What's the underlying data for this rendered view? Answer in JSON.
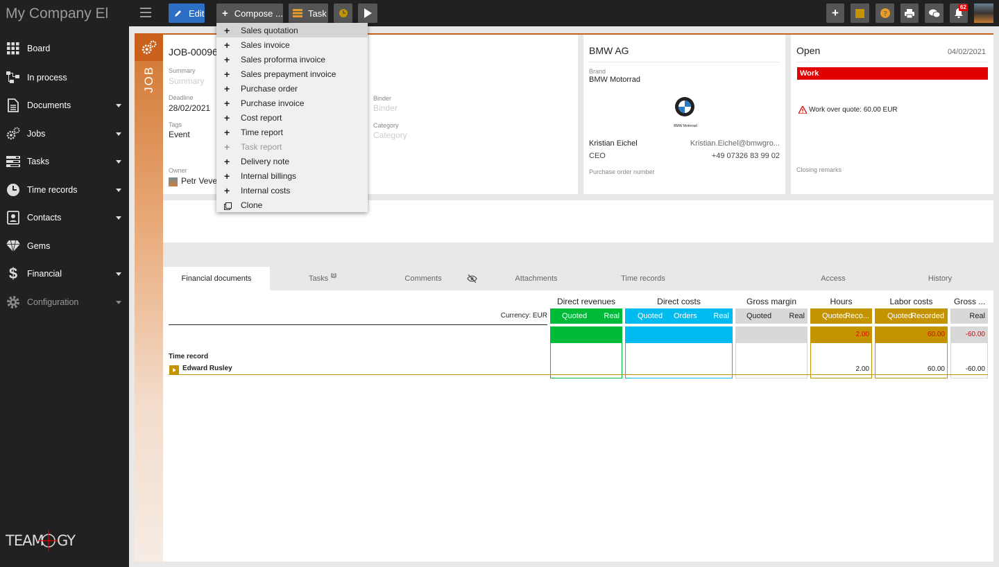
{
  "app": {
    "company": "My Company El",
    "logo_text": "TEAMOGY"
  },
  "toolbar": {
    "edit_label": "Edit",
    "compose_label": "Compose ...",
    "task_label": "Task",
    "notif_count": "62"
  },
  "sidebar": {
    "items": [
      {
        "label": "Board"
      },
      {
        "label": "In process"
      },
      {
        "label": "Documents"
      },
      {
        "label": "Jobs"
      },
      {
        "label": "Tasks"
      },
      {
        "label": "Time records"
      },
      {
        "label": "Contacts"
      },
      {
        "label": "Gems"
      },
      {
        "label": "Financial"
      },
      {
        "label": "Configuration"
      }
    ]
  },
  "compose_menu": {
    "items": [
      {
        "label": "Sales quotation",
        "icon": "plus-icon"
      },
      {
        "label": "Sales invoice",
        "icon": "plus-icon"
      },
      {
        "label": "Sales proforma invoice",
        "icon": "plus-icon"
      },
      {
        "label": "Sales prepayment invoice",
        "icon": "plus-icon"
      },
      {
        "label": "Purchase order",
        "icon": "plus-icon"
      },
      {
        "label": "Purchase invoice",
        "icon": "plus-icon"
      },
      {
        "label": "Cost report",
        "icon": "plus-icon"
      },
      {
        "label": "Time report",
        "icon": "plus-icon"
      },
      {
        "label": "Task report",
        "icon": "plus-icon"
      },
      {
        "label": "Delivery note",
        "icon": "plus-icon"
      },
      {
        "label": "Internal billings",
        "icon": "plus-icon"
      },
      {
        "label": "Internal costs",
        "icon": "plus-icon"
      },
      {
        "label": "Clone",
        "icon": "clone-icon"
      }
    ]
  },
  "job": {
    "vertical_label": "JOB",
    "number": "JOB-00096",
    "summary_label": "Summary",
    "summary_placeholder": "Summary",
    "deadline_label": "Deadline",
    "deadline": "28/02/2021",
    "tags_label": "Tags",
    "tags": "Event",
    "owner_label": "Owner",
    "owner": "Petr Vever",
    "binder_label": "Binder",
    "binder_placeholder": "Binder",
    "category_label": "Category",
    "category_placeholder": "Category"
  },
  "client": {
    "name": "BMW AG",
    "brand_label": "Brand",
    "brand": "BMW Motorrad",
    "logo_caption": "BMW Motorrad",
    "contact_name": "Kristian Eichel",
    "contact_email": "Kristian.Eichel@bmwgro...",
    "contact_role": "CEO",
    "contact_phone": "+49 07326 83 99 02",
    "po_label": "Purchase order number"
  },
  "status": {
    "state": "Open",
    "date": "04/02/2021",
    "badge": "Work",
    "warning": "Work over quote: 60.00 EUR",
    "closing_label": "Closing remarks"
  },
  "tabs": [
    {
      "label": "Financial documents"
    },
    {
      "label": "Tasks",
      "badge": "0"
    },
    {
      "label": "Comments"
    },
    {
      "label": "Attachments"
    },
    {
      "label": "Time records"
    },
    {
      "label": "Access"
    },
    {
      "label": "History"
    }
  ],
  "financial": {
    "currency": "Currency: EUR",
    "groups": {
      "direct_revenues": "Direct revenues",
      "direct_costs": "Direct costs",
      "gross_margin": "Gross margin",
      "hours": "Hours",
      "labor_costs": "Labor costs",
      "gross": "Gross ..."
    },
    "sub": {
      "quoted": "Quoted",
      "real": "Real",
      "orders": "Orders",
      "reco": "Reco...",
      "recorded": "Recorded"
    },
    "totals": {
      "hours": "2.00",
      "labor": "60.00",
      "gross": "-60.00"
    },
    "section": "Time record",
    "row": {
      "name": "Edward Rusley",
      "hours": "2.00",
      "labor": "60.00",
      "gross": "-60.00"
    }
  },
  "colors": {
    "green": "#00bb3a",
    "blue": "#00bbf0",
    "gray": "#d8d8d8",
    "gold": "#c49400",
    "orange": "#c9611d",
    "red": "#e00000"
  }
}
